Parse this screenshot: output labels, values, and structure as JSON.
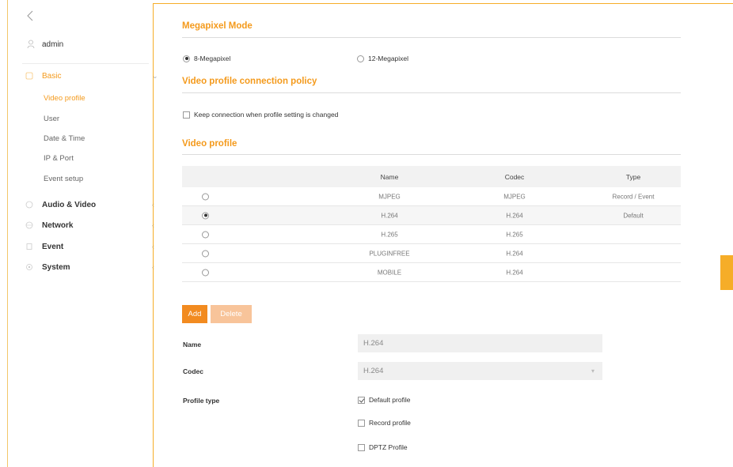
{
  "sidebar": {
    "back_icon": "chevron-left-icon",
    "user": {
      "name": "admin",
      "icon": "user-icon"
    },
    "groups": [
      {
        "label": "Basic",
        "icon": "basic-icon",
        "caret": "⌄",
        "active": true
      },
      {
        "label": "Audio & Video",
        "icon": "audio-video-icon",
        "caret": "‹"
      },
      {
        "label": "Network",
        "icon": "network-icon",
        "caret": "‹"
      },
      {
        "label": "Event",
        "icon": "event-icon",
        "caret": "‹"
      },
      {
        "label": "System",
        "icon": "system-icon",
        "caret": "‹"
      }
    ],
    "sub_items": [
      "Video profile",
      "User",
      "Date & Time",
      "IP & Port",
      "Event setup"
    ]
  },
  "megapixel": {
    "title": "Megapixel Mode",
    "options": [
      "8-Megapixel",
      "12-Megapixel"
    ],
    "selected": "8-Megapixel"
  },
  "policy": {
    "title": "Video profile connection policy",
    "checkbox_label": "Keep connection when profile setting is changed",
    "checked": false
  },
  "video_profile": {
    "title": "Video profile",
    "columns": [
      "Name",
      "Codec",
      "Type"
    ],
    "rows": [
      {
        "name": "MJPEG",
        "codec": "MJPEG",
        "type": "Record / Event",
        "selected": false
      },
      {
        "name": "H.264",
        "codec": "H.264",
        "type": "Default",
        "selected": true
      },
      {
        "name": "H.265",
        "codec": "H.265",
        "type": "",
        "selected": false
      },
      {
        "name": "PLUGINFREE",
        "codec": "H.264",
        "type": "",
        "selected": false
      },
      {
        "name": "MOBILE",
        "codec": "H.264",
        "type": "",
        "selected": false
      }
    ],
    "add_label": "Add",
    "delete_label": "Delete"
  },
  "form": {
    "name_label": "Name",
    "name_value": "H.264",
    "codec_label": "Codec",
    "codec_value": "H.264",
    "profile_type_label": "Profile type",
    "profile_types": [
      {
        "label": "Default profile",
        "checked": true
      },
      {
        "label": "Record profile",
        "checked": false
      },
      {
        "label": "DPTZ Profile",
        "checked": false
      }
    ]
  },
  "colors": {
    "accent": "#f49a1c",
    "add_button": "#f28b20",
    "delete_button": "#f8c49a",
    "border": "#f6ad28"
  }
}
